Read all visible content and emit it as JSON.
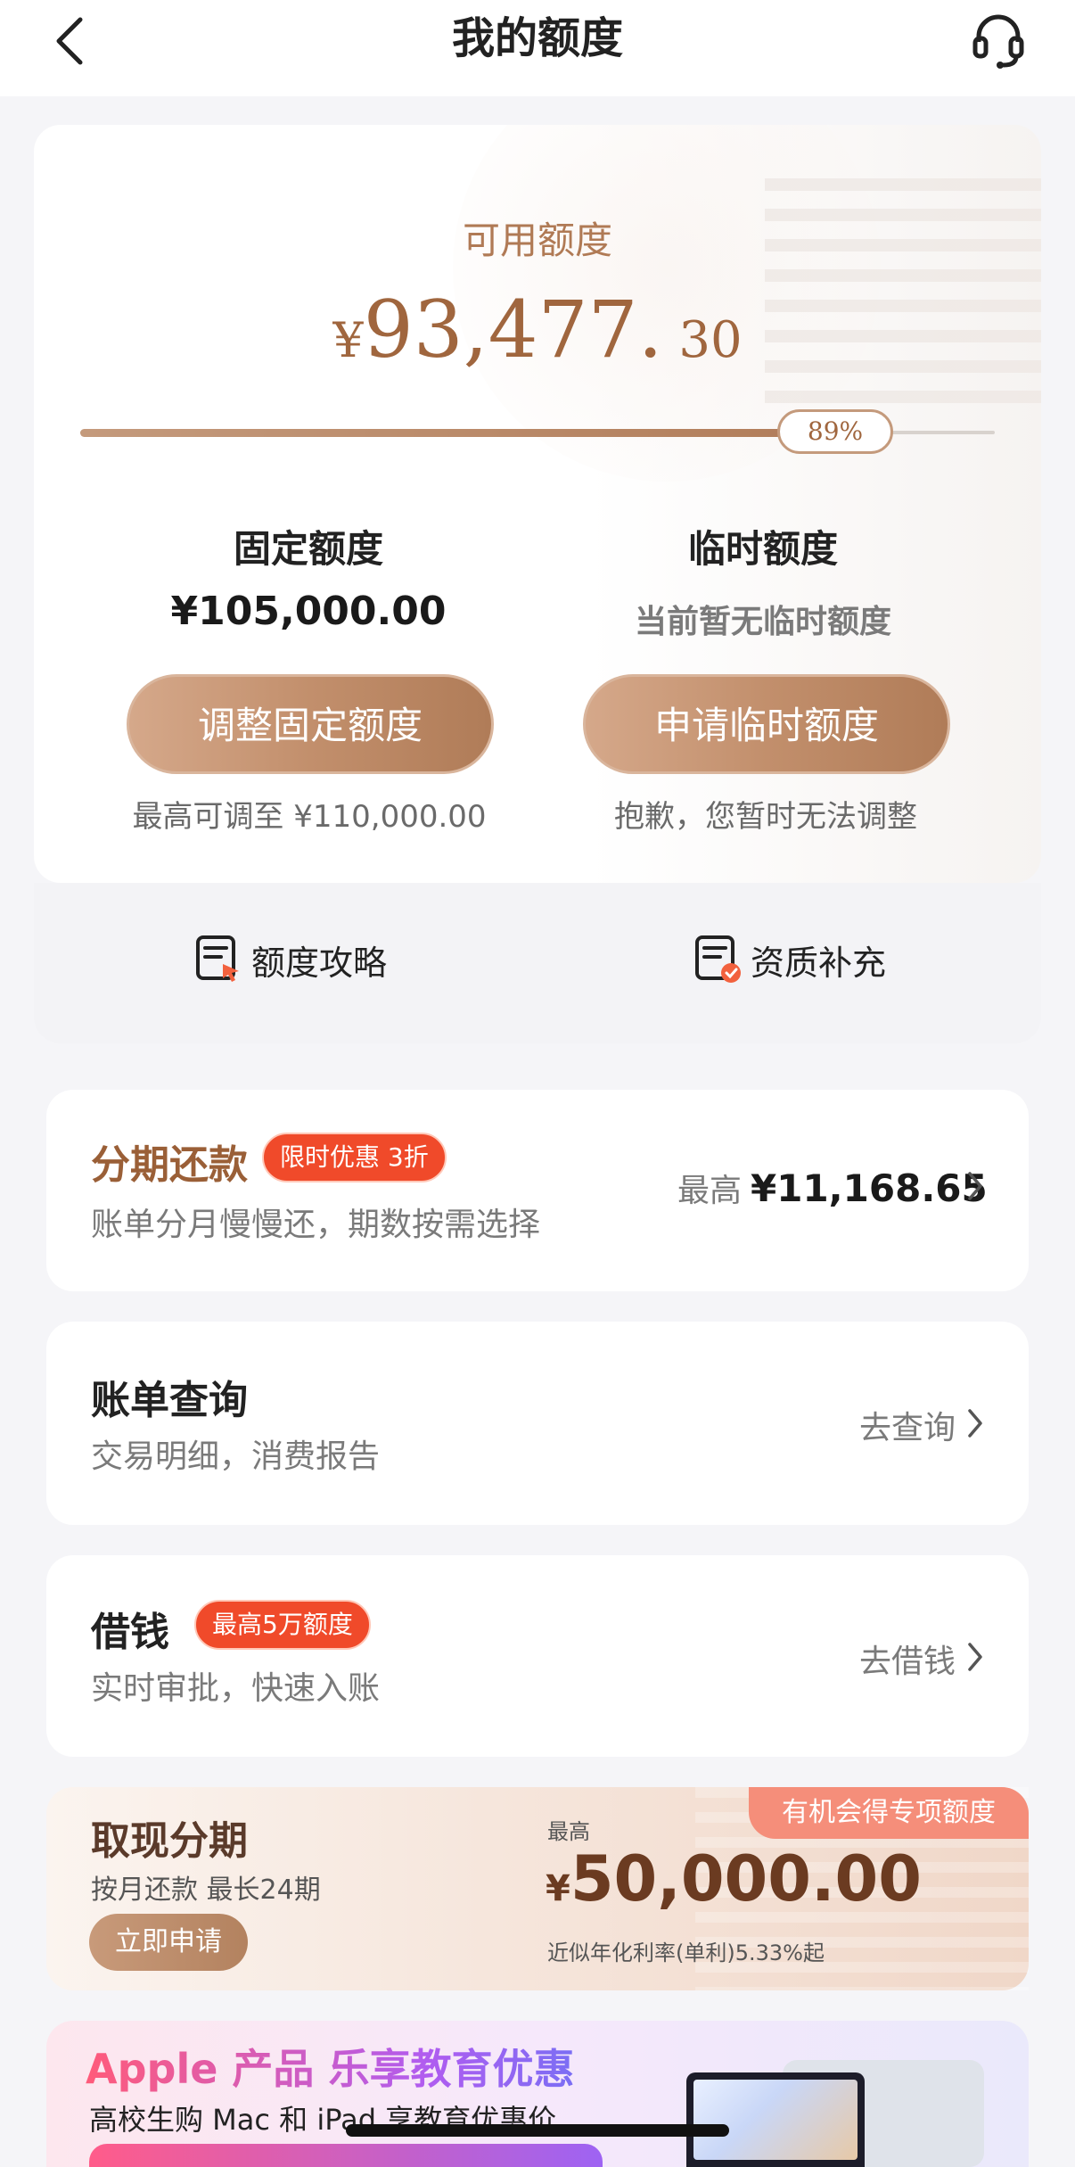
{
  "header": {
    "title": "我的额度",
    "back_icon": "chevron-left-icon",
    "service_icon": "headset-icon"
  },
  "credit": {
    "available_label": "可用额度",
    "available_currency": "¥",
    "available_integer": "93,477.",
    "available_decimal": " 30",
    "usage_fraction": 0.89,
    "usage_percent_label": "89%",
    "fixed": {
      "title": "固定额度",
      "amount": "¥105,000.00",
      "button_label": "调整固定额度",
      "hint": "最高可调至 ¥110,000.00"
    },
    "temporary": {
      "title": "临时额度",
      "status": "当前暂无临时额度",
      "button_label": "申请临时额度",
      "hint": "抱歉，您暂时无法调整"
    }
  },
  "quick_links": [
    {
      "label": "额度攻略",
      "icon": "guide-doc-icon"
    },
    {
      "label": "资质补充",
      "icon": "supplement-doc-icon"
    }
  ],
  "installment": {
    "title": "分期还款",
    "badge": "限时优惠 3折",
    "subtitle": "账单分月慢慢还，期数按需选择",
    "right_prefix": "最高",
    "right_amount": "¥11,168.65"
  },
  "bill": {
    "title": "账单查询",
    "subtitle": "交易明细，消费报告",
    "action": "去查询"
  },
  "borrow": {
    "title": "借钱",
    "badge": "最高5万额度",
    "subtitle": "实时审批，快速入账",
    "action": "去借钱"
  },
  "cash_installment": {
    "title": "取现分期",
    "subtitle": "按月还款 最长24期",
    "button_label": "立即申请",
    "ribbon": "有机会得专项额度",
    "max_label": "最高",
    "currency": "¥",
    "amount": "50,000.00",
    "rate": "近似年化利率(单利)5.33%起"
  },
  "apple_promo": {
    "title": "Apple 产品 乐享教育优惠",
    "subtitle": "高校生购 Mac 和 iPad 享教育优惠价"
  },
  "colors": {
    "accent_brown": "#a0663e",
    "button_gradient_start": "#d5a88a",
    "button_gradient_end": "#b07c58",
    "promo_red": "#f04a2a"
  }
}
